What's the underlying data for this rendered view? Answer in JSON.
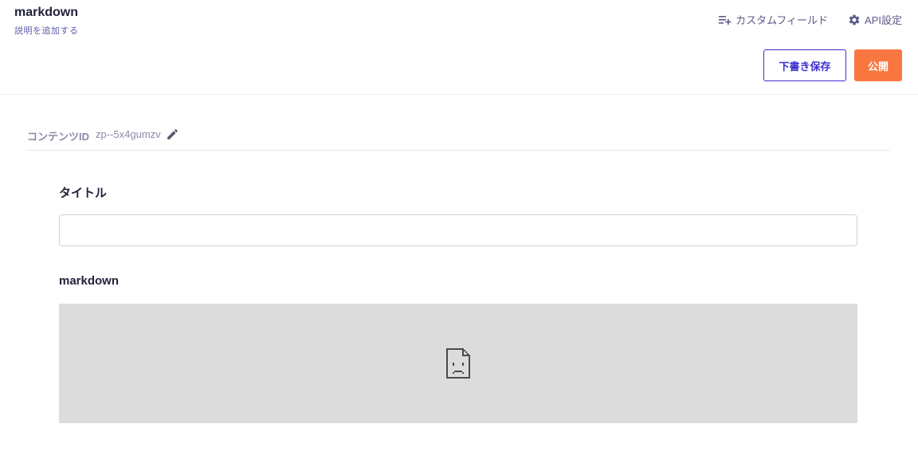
{
  "header": {
    "api_name": "markdown",
    "description_placeholder": "説明を追加する",
    "links": {
      "custom_field": {
        "label": "カスタムフィールド",
        "icon": "playlist-add-icon"
      },
      "api_settings": {
        "label": "API設定",
        "icon": "gear-icon"
      }
    },
    "actions": {
      "draft_label": "下書き保存",
      "publish_label": "公開"
    }
  },
  "content_id": {
    "label": "コンテンツID",
    "value": "zp--5x4gumzv",
    "edit_icon": "pencil-icon"
  },
  "fields": {
    "title": {
      "label": "タイトル",
      "value": ""
    },
    "markdown": {
      "label": "markdown",
      "frame_icon": "broken-document-icon"
    }
  },
  "colors": {
    "primary": "#3c2fcf",
    "publish": "#f8763f",
    "muted": "#8a89a8",
    "frame_bg": "#dcdcdc"
  }
}
